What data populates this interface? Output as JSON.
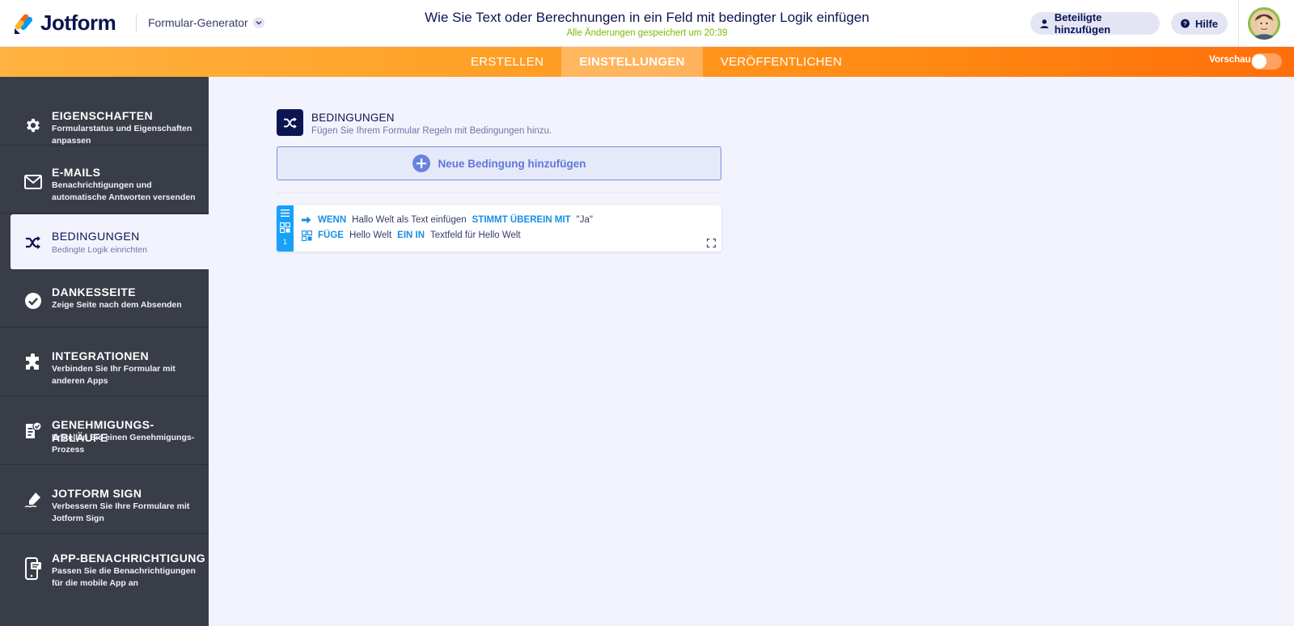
{
  "header": {
    "logo_text": "Jotform",
    "builder_label": "Formular-Generator",
    "form_title": "Wie Sie Text oder Berechnungen in ein Feld mit bedingter Logik einfügen",
    "saved_status": "Alle Änderungen gespeichert um 20:39",
    "invite_label": "Beteiligte hinzufügen",
    "help_label": "Hilfe"
  },
  "navbar": {
    "tabs": [
      {
        "label": "ERSTELLEN",
        "active": false
      },
      {
        "label": "EINSTELLUNGEN",
        "active": true
      },
      {
        "label": "VERÖFFENTLICHEN",
        "active": false
      }
    ],
    "preview_label": "Vorschau"
  },
  "sidebar": {
    "items": [
      {
        "title": "EIGENSCHAFTEN",
        "desc": "Formularstatus und Eigenschaften anpassen",
        "icon": "gear-icon"
      },
      {
        "title": "E-MAILS",
        "desc": "Benachrichtigungen und automatische Antworten versenden",
        "icon": "envelope-icon"
      },
      {
        "title": "BEDINGUNGEN",
        "desc": "Bedingte Logik einrichten",
        "icon": "shuffle-icon",
        "active": true
      },
      {
        "title": "DANKESSEITE",
        "desc": "Zeige Seite nach dem Absenden",
        "icon": "check-circle-icon"
      },
      {
        "title": "INTEGRATIONEN",
        "desc": "Verbinden Sie Ihr Formular mit anderen Apps",
        "icon": "puzzle-icon"
      },
      {
        "title": "GENEHMIGUNGS-ABLÄUFE",
        "desc": "Erstellen Sie einen Genehmigungs-Prozess",
        "icon": "approval-icon"
      },
      {
        "title": "JOTFORM SIGN",
        "desc": "Verbessern Sie Ihre Formulare mit Jotform Sign",
        "icon": "pen-sign-icon"
      },
      {
        "title": "APP-BENACHRICHTIGUNG",
        "desc": "Passen Sie die Benachrichtigungen für die mobile App an",
        "icon": "mobile-notification-icon"
      }
    ]
  },
  "conditions": {
    "title": "BEDINGUNGEN",
    "subtitle": "Fügen Sie Ihrem Formular Regeln mit Bedingungen hinzu.",
    "add_label": "Neue Bedingung hinzufügen",
    "rules": [
      {
        "number": "1",
        "if_keyword": "WENN",
        "if_field": "Hallo Welt als Text einfügen",
        "operator": "STIMMT ÜBEREIN MIT",
        "value": "\"Ja\"",
        "action_keyword": "FÜGE",
        "action_value": "Hello Welt",
        "into_keyword": "EIN IN",
        "target_field": "Textfeld für Hello Welt"
      }
    ]
  },
  "colors": {
    "navy": "#0a1551",
    "orange_start": "#ffb340",
    "orange_end": "#ff6e0a",
    "sidebar_bg": "#383d47",
    "rule_blue": "#18a0fb",
    "saved_green": "#78bb07",
    "add_blue": "#5f78d9"
  }
}
